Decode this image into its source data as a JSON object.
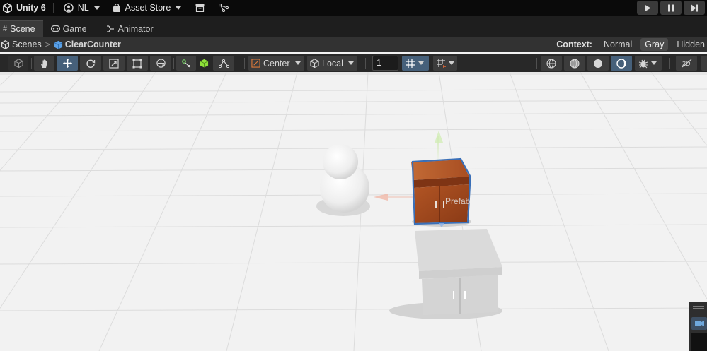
{
  "topbar": {
    "app_title": "Unity 6",
    "account": "NL",
    "asset_store": "Asset Store"
  },
  "tabs": [
    {
      "label": "Scene",
      "icon": "grid-icon",
      "active": true
    },
    {
      "label": "Game",
      "icon": "gamepad-icon",
      "active": false
    },
    {
      "label": "Animator",
      "icon": "animator-icon",
      "active": false
    }
  ],
  "breadcrumb": {
    "root": "Scenes",
    "current": "ClearCounter"
  },
  "context": {
    "label": "Context:",
    "options": [
      "Normal",
      "Gray",
      "Hidden"
    ],
    "selected": "Gray"
  },
  "toolbar": {
    "pivot_mode": "Center",
    "pivot_rotation": "Local",
    "grid_size": "1"
  },
  "scene": {
    "overlay_label": "Prefab",
    "colors": {
      "ground": "#f2f2f2",
      "grid_line": "#dedede",
      "counter_wood": "#a0451c",
      "selection_outline": "#3a6fb7"
    }
  }
}
